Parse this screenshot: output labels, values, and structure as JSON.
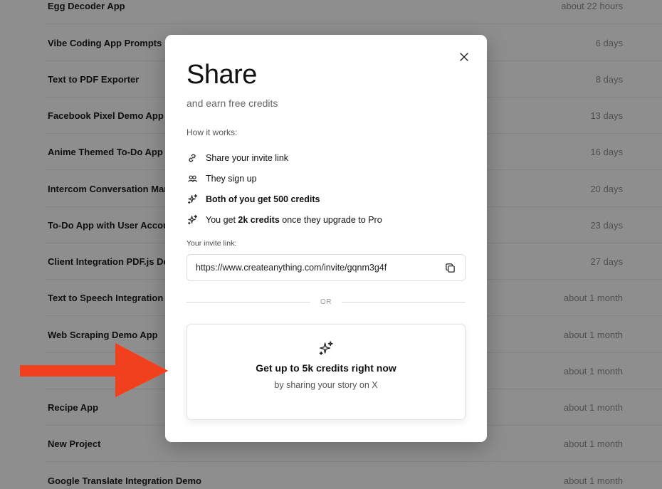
{
  "background_list": [
    {
      "name": "Egg Decoder App",
      "time": "about 22 hours"
    },
    {
      "name": "Vibe Coding App Prompts",
      "time": "6 days"
    },
    {
      "name": "Text to PDF Exporter",
      "time": "8 days"
    },
    {
      "name": "Facebook Pixel Demo App",
      "time": "13 days"
    },
    {
      "name": "Anime Themed To-Do App",
      "time": "16 days"
    },
    {
      "name": "Intercom Conversation Man",
      "time": "20 days"
    },
    {
      "name": "To-Do App with User Accou",
      "time": "23 days"
    },
    {
      "name": "Client Integration PDF.js De",
      "time": "27 days"
    },
    {
      "name": "Text to Speech Integration D",
      "time": "about 1 month"
    },
    {
      "name": "Web Scraping Demo App",
      "time": "about 1 month"
    },
    {
      "name": "",
      "time": "about 1 month"
    },
    {
      "name": "Recipe App",
      "time": "about 1 month"
    },
    {
      "name": "New Project",
      "time": "about 1 month"
    },
    {
      "name": "Google Translate Integration Demo",
      "time": "about 1 month"
    }
  ],
  "modal": {
    "title": "Share",
    "subtitle": "and earn free credits",
    "how_label": "How it works:",
    "steps": [
      {
        "icon": "link-icon",
        "pre": "Share your invite link",
        "bold": "",
        "post": ""
      },
      {
        "icon": "users-icon",
        "pre": "They sign up",
        "bold": "",
        "post": ""
      },
      {
        "icon": "sparkle-icon",
        "pre": "",
        "bold": "Both of you get 500 credits",
        "post": ""
      },
      {
        "icon": "sparkle-icon",
        "pre": "You get ",
        "bold": "2k credits",
        "post": " once they upgrade to Pro"
      }
    ],
    "invite_label": "Your invite link:",
    "invite_url": "https://www.createanything.com/invite/gqnm3g4f",
    "divider_text": "OR",
    "x_card": {
      "headline": "Get up to 5k credits right now",
      "sub": "by sharing your story on X"
    }
  },
  "colors": {
    "arrow": "#f0401e",
    "overlay": "rgba(0,0,0,0.42)"
  }
}
